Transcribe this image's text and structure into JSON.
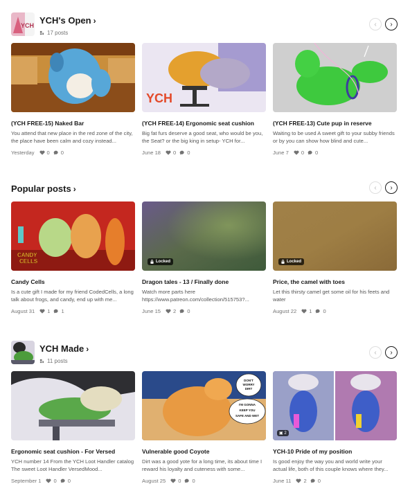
{
  "sections": [
    {
      "title": "YCH's Open",
      "count": "17 posts",
      "cards": [
        {
          "title": "(YCH FREE-15) Naked Bar",
          "desc": "You attend that new place in the red zone of the city, the place have been calm and cozy instead...",
          "date": "Yesterday",
          "likes": "0",
          "comments": "0"
        },
        {
          "title": "(YCH FREE-14) Ergonomic seat cushion",
          "desc": "Big fat furs deserve a good seat, who would be you, the Seat? or the big king in setup- YCH for...",
          "date": "June 18",
          "likes": "0",
          "comments": "0"
        },
        {
          "title": "(YCH FREE-13) Cute pup in reserve",
          "desc": "Waiting to be used A sweet gift to your subby friends or by you can show how blind and cute...",
          "date": "June 7",
          "likes": "0",
          "comments": "0"
        }
      ]
    },
    {
      "title": "Popular posts",
      "cards": [
        {
          "title": "Candy Cells",
          "desc": "Is a cute gift I made for my friend CodedCells, a long talk about frogs, and candy, end up with me...",
          "date": "August 31",
          "likes": "1",
          "comments": "1",
          "image_text": [
            "CANDY",
            "CELLS"
          ]
        },
        {
          "title": "Dragon tales - 13 / Finally done",
          "desc": "Watch more parts here https://www.patreon.com/collection/515753?...",
          "date": "June 15",
          "likes": "2",
          "comments": "0",
          "locked": "Locked"
        },
        {
          "title": "Price, the camel with toes",
          "desc": "Let this thirsty camel get some oil for his feets and water",
          "date": "August 22",
          "likes": "1",
          "comments": "0",
          "locked": "Locked"
        }
      ]
    },
    {
      "title": "YCH Made",
      "count": "11 posts",
      "cards": [
        {
          "title": "Ergonomic seat cushion - For Versed",
          "desc": "YCH number 14 From the YCH Loot Handler catalog The sweet Loot Handler VersedMood...",
          "date": "September 1",
          "likes": "0",
          "comments": "0"
        },
        {
          "title": "Vulnerable good Coyote",
          "desc": "Dirt was a good yote for a long time, its about time I reward his loyalty and cuteness with some...",
          "date": "August 25",
          "likes": "0",
          "comments": "0",
          "speech": [
            "DON'T",
            "WORRY",
            "DIRT",
            "I'M GONNA",
            "KEEP YOU",
            "SAFE AND WET"
          ]
        },
        {
          "title": "YCH-10 Pride of my position",
          "desc": "Is good enjoy the way you and world write your actual life, both of this couple knows where they...",
          "date": "June 11",
          "likes": "2",
          "comments": "0",
          "image_count": "2"
        }
      ]
    }
  ],
  "thumb_text": "YCH",
  "colors": {
    "accent": "#191919",
    "muted": "#737373",
    "border": "#dedede"
  }
}
